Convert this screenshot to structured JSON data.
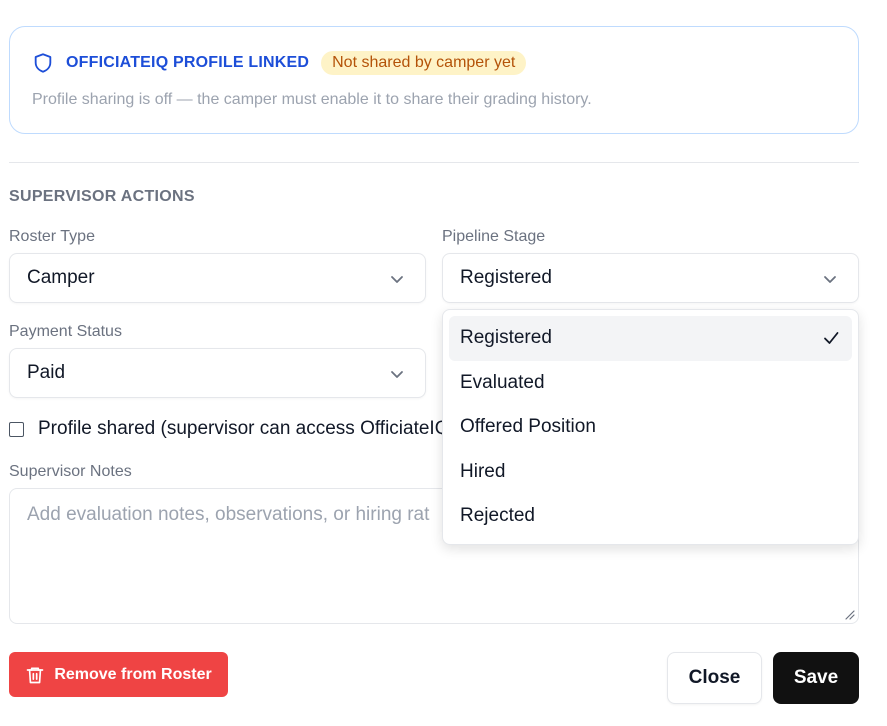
{
  "profile_card": {
    "title": "OFFICIATEIQ PROFILE LINKED",
    "badge": "Not shared by camper yet",
    "description": "Profile sharing is off — the camper must enable it to share their grading history.",
    "icon": "shield-icon",
    "accent_color": "#1d4ed8",
    "badge_bg": "#fef3c7",
    "badge_color": "#b45309"
  },
  "section": {
    "title": "SUPERVISOR ACTIONS"
  },
  "roster_type": {
    "label": "Roster Type",
    "value": "Camper"
  },
  "pipeline_stage": {
    "label": "Pipeline Stage",
    "value": "Registered",
    "options": [
      {
        "label": "Registered",
        "selected": true
      },
      {
        "label": "Evaluated",
        "selected": false
      },
      {
        "label": "Offered Position",
        "selected": false
      },
      {
        "label": "Hired",
        "selected": false
      },
      {
        "label": "Rejected",
        "selected": false
      }
    ]
  },
  "payment_status": {
    "label": "Payment Status",
    "value": "Paid"
  },
  "profile_shared": {
    "label": "Profile shared (supervisor can access OfficiateIQ",
    "checked": false
  },
  "notes": {
    "label": "Supervisor Notes",
    "placeholder": "Add evaluation notes, observations, or hiring rat"
  },
  "buttons": {
    "remove": "Remove from Roster",
    "close": "Close",
    "save": "Save",
    "remove_color": "#ef4444",
    "save_color": "#111111"
  }
}
